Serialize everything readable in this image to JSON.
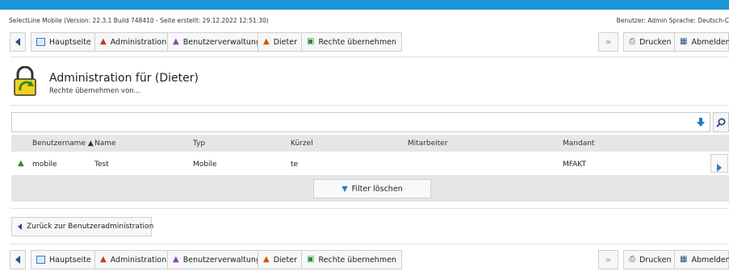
{
  "info": {
    "version_text": "SelectLine Mobile (Version: 22.3.1 Build 748410 - Seite erstellt: 29.12.2022 12:51:30)",
    "user_text": "Benutzer: Admin  Sprache: Deutsch-C"
  },
  "toolbar": {
    "home": "Hauptseite",
    "administration": "Administration",
    "user_admin": "Benutzerverwaltung",
    "user": "Dieter",
    "rights": "Rechte übernehmen",
    "print": "Drucken",
    "logout": "Abmelden"
  },
  "page": {
    "title": "Administration für (Dieter)",
    "subtitle": "Rechte übernehmen von..."
  },
  "search": {
    "value": "",
    "placeholder": ""
  },
  "table": {
    "columns": {
      "username": "Benutzername",
      "name": "Name",
      "type": "Typ",
      "short": "Kürzel",
      "employee": "Mitarbeiter",
      "client": "Mandant"
    },
    "rows": [
      {
        "username": "mobile",
        "name": "Test",
        "type": "Mobile",
        "short": "te",
        "employee": "",
        "client": "MFAKT"
      }
    ]
  },
  "filter": {
    "clear_label": "Filter löschen"
  },
  "back": {
    "label": "Zurück zur Benutzeradministration"
  },
  "colors": {
    "accent": "#1a95d6",
    "header_bg": "#e6e6e6"
  },
  "icons": [
    "back-icon",
    "home-icon",
    "user-icon",
    "glasses-icon",
    "print-icon",
    "logout-icon",
    "lock-icon",
    "search-icon",
    "filter-icon",
    "arrow-right-icon"
  ]
}
